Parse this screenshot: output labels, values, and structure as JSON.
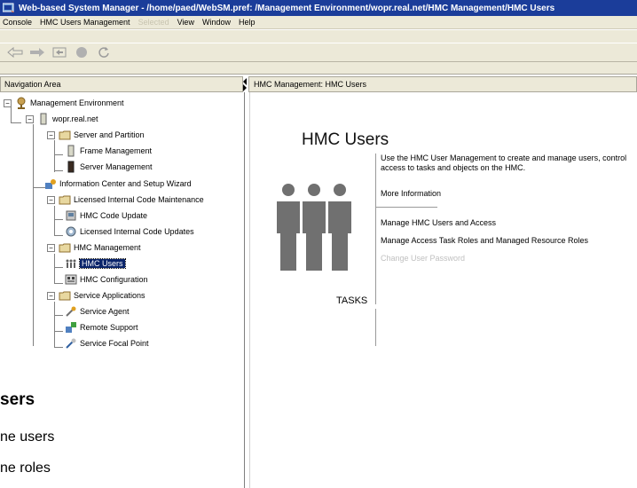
{
  "window": {
    "title": "Web-based System Manager - /home/paed/WebSM.pref: /Management Environment/wopr.real.net/HMC Management/HMC Users"
  },
  "menu": {
    "items": [
      "Console",
      "HMC Users Management",
      "Selected",
      "View",
      "Window",
      "Help"
    ]
  },
  "toolbar": {
    "buttons": [
      "back-icon",
      "forward-icon",
      "up-icon",
      "stop-icon",
      "refresh-icon"
    ]
  },
  "nav": {
    "header": "Navigation Area",
    "tree": [
      {
        "label": "Management Environment",
        "icon": "globe-person-icon"
      },
      {
        "label": "wopr.real.net",
        "icon": "server-icon"
      },
      {
        "label": "Server and Partition",
        "icon": "folder-icon"
      },
      {
        "label": "Frame Management",
        "icon": "frame-icon"
      },
      {
        "label": "Server Management",
        "icon": "server-dark-icon"
      },
      {
        "label": "Information Center and Setup Wizard",
        "icon": "info-wizard-icon"
      },
      {
        "label": "Licensed Internal Code Maintenance",
        "icon": "folder-icon"
      },
      {
        "label": "HMC Code Update",
        "icon": "hmc-code-icon"
      },
      {
        "label": "Licensed Internal Code Updates",
        "icon": "code-updates-icon"
      },
      {
        "label": "HMC Management",
        "icon": "folder-icon"
      },
      {
        "label": "HMC Users",
        "icon": "users-icon"
      },
      {
        "label": "HMC Configuration",
        "icon": "config-icon"
      },
      {
        "label": "Service Applications",
        "icon": "folder-icon"
      },
      {
        "label": "Service Agent",
        "icon": "wrench-icon"
      },
      {
        "label": "Remote Support",
        "icon": "remote-icon"
      },
      {
        "label": "Service Focal Point",
        "icon": "wrench-icon"
      }
    ]
  },
  "content": {
    "header": "HMC Management: HMC Users",
    "title": "HMC Users",
    "description": "Use the HMC User Management to create and manage users, control access to tasks and objects on the HMC.",
    "more_info": "More Information",
    "tasks": [
      {
        "label": "Manage HMC Users and Access",
        "enabled": true
      },
      {
        "label": "Manage Access Task Roles and Managed Resource Roles",
        "enabled": true
      },
      {
        "label": "Change User Password",
        "enabled": false
      }
    ],
    "tasks_label": "TASKS"
  },
  "overlay": {
    "title": "sers",
    "line1": "ne users",
    "line2": "ne roles"
  },
  "colors": {
    "title_bar": "#1b3d9a",
    "chrome": "#ece9d8",
    "selection": "#0a246a",
    "people_icon": "#707070"
  }
}
